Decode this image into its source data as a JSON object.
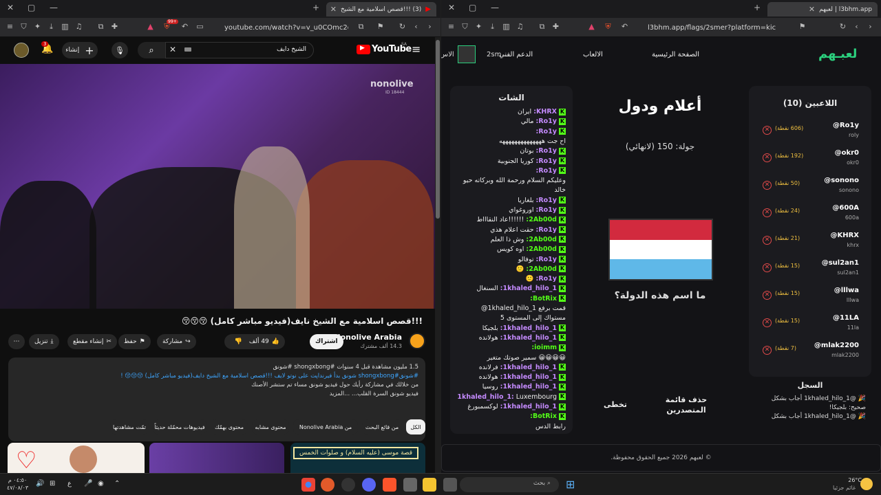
{
  "left_window": {
    "tab_title": "(3) !!!قصص اسلامية مع الشيخ",
    "url": "youtube.com/watch?v=v_u0COmc2dg",
    "brave_badge": "99+",
    "youtube": {
      "logo": "YouTube",
      "region": "SA",
      "search_value": "الشيخ دايف",
      "create_label": "إنشاء",
      "notif_count": "3",
      "video_overlay": "nonolive",
      "video_overlay_sub": "ID 18444",
      "title": "!!!قصص اسلامية مع الشيخ نايف(فيديو مباشر كامل) 😚😚😚",
      "channel": "Nonolive Arabia",
      "subs": "14.3 ألف مشترك",
      "subscribe": "اشتراك",
      "likes": "49 ألف",
      "share": "مشاركة",
      "save": "حفظ",
      "clip": "إنشاء مقطع",
      "download": "تنزيل",
      "desc_line1": "1.5 مليون مشاهدة قبل 4 سنوات #shongxbong #شونق",
      "desc_line2": "#شونق#shongxbong شونق بدأ فيرنداپت على نوتو لايف !!!قصص اسلامية مع الشيخ دايف(فيديو مباشر كامل) 😚😚😚 !",
      "desc_line3": "من خلالك في مشاركة رأيك حول فيديو شونق مساء تم ستشر الأصنك",
      "desc_line4": "فيديو شونق السرة القلب... ...المزيد",
      "chips": [
        "الكل",
        "من قائع البحث",
        "من Nonolive Arabia",
        "محتوى مشابه",
        "محتوى بهمّك",
        "فيديوهات محمّلة حديثاً",
        "تمّت مشاهدتها"
      ],
      "rec_text": "قصة موسى (عليه السلام) و صلوات الخمس"
    }
  },
  "right_window": {
    "tab_title": "l3bhm.app | لعبهم",
    "url": "l3bhm.app/flags/2smer?platform=kick",
    "site": {
      "logo": "لعبـهم",
      "nav": [
        "الصفحة الرئيسية",
        "الالعاب",
        "الدعم الفني",
        "الاس"
      ],
      "user": "2sm",
      "chat_title": "الشات",
      "game_title": "أعلام ودول",
      "round": "جولة: 150 (لانهائي)",
      "question": "ما اسم هذه الدولة؟",
      "reset_board": "حذف قائمة المتصدرين",
      "skip": "تخطى",
      "players_title": "اللاعبين (10)",
      "players": [
        {
          "name": "@Ro1y",
          "user": "roly",
          "points": "(606 نقطة)"
        },
        {
          "name": "@okr0",
          "user": "okr0",
          "points": "(192 نقطة)"
        },
        {
          "name": "@sonono",
          "user": "sonono",
          "points": "(50 نقطة)"
        },
        {
          "name": "@600A",
          "user": "600a",
          "points": "(24 نقطة)"
        },
        {
          "name": "@KHRX",
          "user": "khrx",
          "points": "(21 نقطة)"
        },
        {
          "name": "@sul2an1",
          "user": "sul2an1",
          "points": "(15 نقطة)"
        },
        {
          "name": "@lllwa",
          "user": "lllwa",
          "points": "(15 نقطة)"
        },
        {
          "name": "@11LA",
          "user": "11la",
          "points": "(15 نقطة)"
        },
        {
          "name": "@mlak2200",
          "user": "mlak2200",
          "points": "(7 نقطة)"
        }
      ],
      "log_title": "السجل",
      "log": [
        "🎉 @1khaled_hilo_1 أجاب بشكل",
        "صحيح: بلجيكا!",
        "🎉 @1khaled_hilo_1 أجاب بشكل"
      ],
      "footer": "© لعبهم 2026 جميع الحقوق محفوظة.",
      "chat": [
        {
          "u": "KHRX:",
          "m": "ايران",
          "c": "umag"
        },
        {
          "u": "Ro1y:",
          "m": "مالي",
          "c": "umag"
        },
        {
          "u": "Ro1y:",
          "m": "",
          "c": "umag"
        },
        {
          "u": "",
          "m": "اح جت ههههههههههههههه",
          "c": "umag"
        },
        {
          "u": "Ro1y:",
          "m": "بوتان",
          "c": "umag"
        },
        {
          "u": "Ro1y:",
          "m": "كوريا الجنوبية",
          "c": "umag"
        },
        {
          "u": "Ro1y:",
          "m": "",
          "c": "umag"
        },
        {
          "u": "",
          "m": "وعليكم السلام ورحمة الله وبركاته حيو",
          "c": "umag"
        },
        {
          "u": "",
          "m": "خالد",
          "c": "umag"
        },
        {
          "u": "Ro1y:",
          "m": "بلغاريا",
          "c": "umag"
        },
        {
          "u": "Ro1y:",
          "m": "اوروغواي",
          "c": "umag"
        },
        {
          "u": "2Ab00d:",
          "m": "!!!!!!عاد النقاااط",
          "c": "uname"
        },
        {
          "u": "Ro1y:",
          "m": "حقت اعلام هذي",
          "c": "umag"
        },
        {
          "u": "2Ab00d:",
          "m": "وش ذا العلم",
          "c": "uname"
        },
        {
          "u": "2Ab00d:",
          "m": "اوه كويس",
          "c": "uname"
        },
        {
          "u": "Ro1y:",
          "m": "توفالو",
          "c": "umag"
        },
        {
          "u": "2Ab00d:",
          "m": "🙂",
          "c": "uname"
        },
        {
          "u": "Ro1y:",
          "m": "🙂",
          "c": "umag"
        },
        {
          "u": "1khaled_hilo_1:",
          "m": "السنغال",
          "c": "umag"
        },
        {
          "u": "BotRix:",
          "m": "",
          "c": "uname"
        },
        {
          "u": "",
          "m": "قمت برفع 1khaled_hilo_1@",
          "c": "uname"
        },
        {
          "u": "",
          "m": "مستواك إلى المستوى 5",
          "c": "uname"
        },
        {
          "u": "1khaled_hilo_1:",
          "m": "بلجيكا",
          "c": "umag"
        },
        {
          "u": "1khaled_hilo_1:",
          "m": "هولانده",
          "c": "umag"
        },
        {
          "u": "ioimm:",
          "m": "",
          "c": "uname"
        },
        {
          "u": "",
          "m": "😀😀😀😀 سمير صوتك متغير",
          "c": "uname"
        },
        {
          "u": "1khaled_hilo_1:",
          "m": "فرلانده",
          "c": "umag"
        },
        {
          "u": "1khaled_hilo_1:",
          "m": "هولانده",
          "c": "umag"
        },
        {
          "u": "1khaled_hilo_1:",
          "m": "روسيا",
          "c": "umag"
        },
        {
          "u": "1khaled_hilo_1:",
          "m": "Luxembourg",
          "c": "umag"
        },
        {
          "u": "1khaled_hilo_1:",
          "m": "لوكسمبورغ",
          "c": "umag"
        },
        {
          "u": "BotRix:",
          "m": "",
          "c": "uname"
        },
        {
          "u": "",
          "m": "رابط الدس",
          "c": "uname"
        }
      ]
    }
  },
  "taskbar": {
    "time": "٠٤:٥٠ م",
    "date": "٤٧/٠٨/٠٣",
    "lang": "ع",
    "search": "بحث",
    "weather_temp": "26°C",
    "weather_desc": "غائم جزئيا"
  }
}
